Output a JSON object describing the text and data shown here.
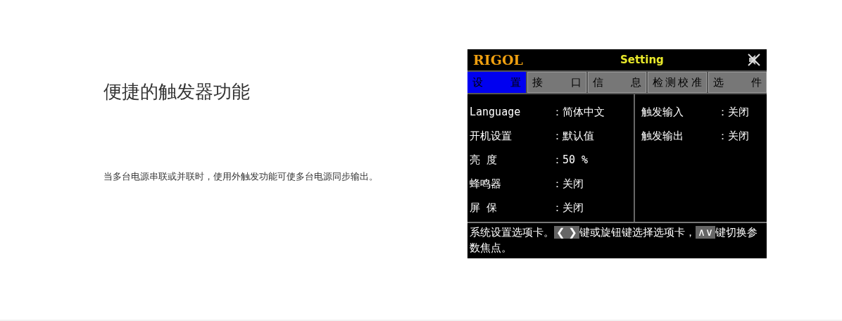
{
  "feature": {
    "heading": "便捷的触发器功能",
    "description": "当多台电源串联或并联时，使用外触发功能可使多台电源同步输出。"
  },
  "device_screen": {
    "logo": "RIGOL",
    "title": "Setting",
    "muted": true,
    "tabs": [
      {
        "label": "设 置",
        "selected": true
      },
      {
        "label": "接 口",
        "selected": false
      },
      {
        "label": "信 息",
        "selected": false
      },
      {
        "label": "检测校准",
        "selected": false
      },
      {
        "label": "选 件",
        "selected": false
      }
    ],
    "left_settings": [
      {
        "label": "Language",
        "value": "：简体中文"
      },
      {
        "label": "开机设置",
        "value": "：默认值"
      },
      {
        "label": "亮 度",
        "value": "：50 %"
      },
      {
        "label": "蜂鸣器",
        "value": "：关闭"
      },
      {
        "label": "屏 保",
        "value": "：关闭"
      }
    ],
    "right_settings": [
      {
        "label": "触发输入",
        "value": "：关闭"
      },
      {
        "label": "触发输出",
        "value": "：关闭"
      }
    ],
    "help": [
      {
        "kind": "text",
        "text": "系统设置选项卡。"
      },
      {
        "kind": "key",
        "text": "❮ ❯"
      },
      {
        "kind": "text",
        "text": "键或旋钮键选择选项卡，"
      },
      {
        "kind": "key",
        "text": "∧∨"
      },
      {
        "kind": "text",
        "text": "键切换参数焦点。"
      }
    ]
  }
}
